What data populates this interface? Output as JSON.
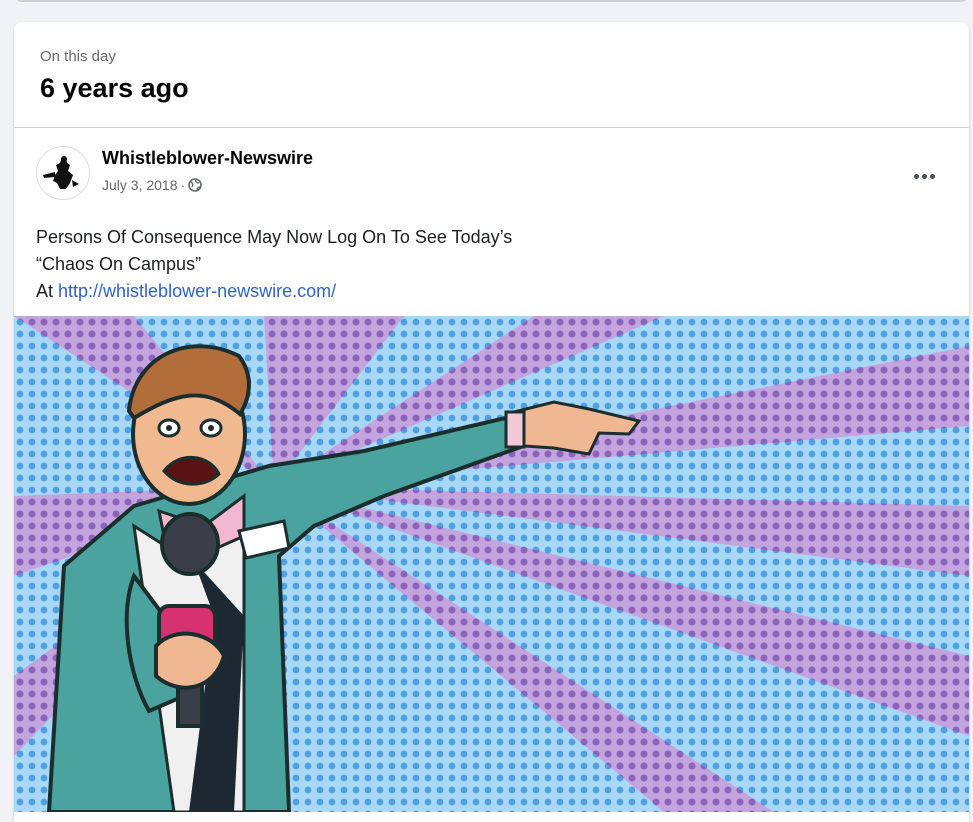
{
  "memory": {
    "kicker": "On this day",
    "title": "6 years ago"
  },
  "post": {
    "author": "Whistleblower-Newswire",
    "date": "July 3, 2018",
    "separator": "·",
    "privacy_icon": "globe-icon",
    "more_icon": "more-options-icon",
    "text_line1": "Persons Of Consequence May Now Log On To See Today’s",
    "text_line2": "“Chaos On Campus”",
    "text_line3_prefix": " At ",
    "link": "http://whistleblower-newswire.com/"
  },
  "colors": {
    "link": "#2f63c9",
    "text": "#1c1e21",
    "meta": "#65676b",
    "image_blue": "#7fc0ee",
    "image_purple": "#a57cc7"
  }
}
